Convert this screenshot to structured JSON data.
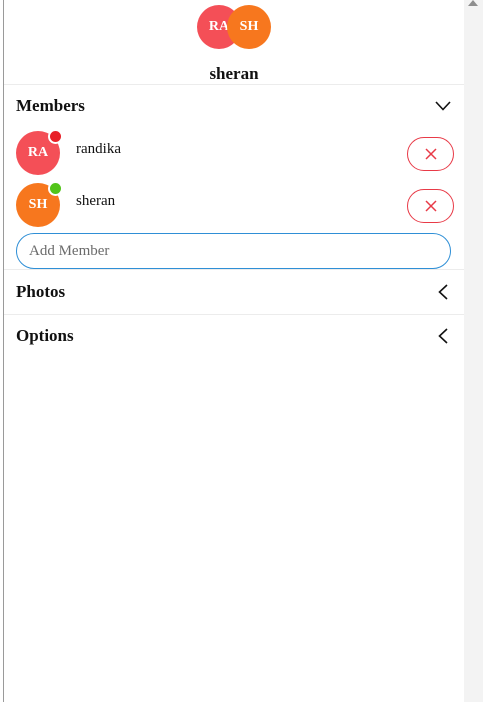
{
  "group": {
    "avatars": [
      {
        "initials": "RA",
        "color": "#f44f57"
      },
      {
        "initials": "SH",
        "color": "#f7771e"
      }
    ],
    "name": "sheran"
  },
  "members_section": {
    "title": "Members",
    "chevron": "chevron-down-icon",
    "members": [
      {
        "initials": "RA",
        "name": "randika",
        "avatar_color": "#f44f57",
        "status_color": "#e82028",
        "remove_icon": "close-icon"
      },
      {
        "initials": "SH",
        "name": "sheran",
        "avatar_color": "#f7771e",
        "status_color": "#52c41a",
        "remove_icon": "close-icon"
      }
    ],
    "add_member_placeholder": "Add Member"
  },
  "photos_section": {
    "title": "Photos",
    "chevron": "chevron-left-icon"
  },
  "options_section": {
    "title": "Options",
    "chevron": "chevron-left-icon"
  },
  "colors": {
    "accent_blue": "#2f8fd6",
    "remove_red": "#e83a47"
  }
}
